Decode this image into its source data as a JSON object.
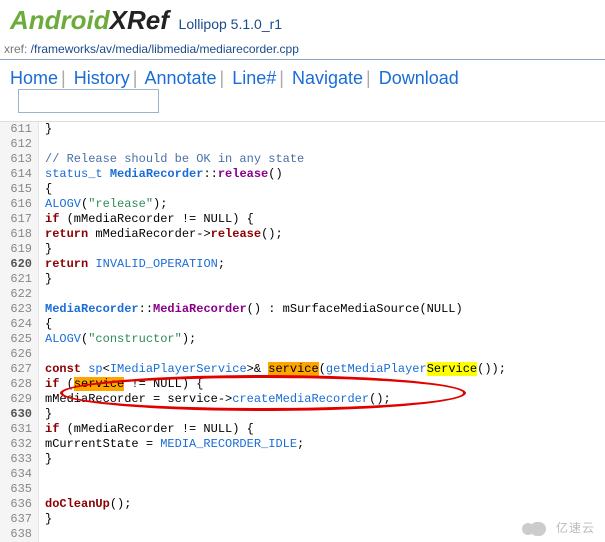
{
  "logo": {
    "part1": "Android",
    "part2": "XRef"
  },
  "version": "Lollipop 5.1.0_r1",
  "path": {
    "label": "xref: ",
    "segments": [
      "/",
      "frameworks",
      "/",
      "av",
      "/",
      "media",
      "/",
      "libmedia",
      "/",
      "mediarecorder.cpp"
    ]
  },
  "nav": {
    "items": [
      "Home",
      "History",
      "Annotate",
      "Line#",
      "Navigate",
      "Download"
    ]
  },
  "search_placeholder": "",
  "code": {
    "l611": "}",
    "l613_cmt": "// Release should be OK in any state",
    "l614": {
      "stat": "status_t",
      "cls": "MediaRecorder",
      "fn": "release",
      "rest": "()"
    },
    "l616": {
      "al": "ALOGV",
      "str": "\"release\""
    },
    "l617": {
      "if": "if",
      "cond": " (mMediaRecorder != NULL) {"
    },
    "l618": {
      "ret": "return",
      "mid": "mMediaRecorder->",
      "fn": "release",
      "end": "();"
    },
    "l619": "    }",
    "l620": {
      "ret": "return",
      "val": "INVALID_OPERATION"
    },
    "l621": "}",
    "l623": {
      "cls1": "MediaRecorder",
      "cls2": "MediaRecorder",
      "rest": "() : mSurfaceMediaSource(NULL)"
    },
    "l625": {
      "al": "ALOGV",
      "str": "\"constructor\""
    },
    "l627": {
      "cn": "const",
      "sp": "sp",
      "imps": "IMediaPlayerService",
      "amp": ">& ",
      "svc": "service",
      "par": "(",
      "get": "getMediaPlayer",
      "svc2": "Service",
      "end": "());"
    },
    "l628": {
      "if": "if",
      "pre": " (",
      "svc": "service",
      "post": " != NULL) {"
    },
    "l629": {
      "lhs": "mMediaRecorder = service->",
      "fn": "createMediaRecorder",
      "end": "();"
    },
    "l630": "    }",
    "l631": {
      "if": "if",
      "cond": " (mMediaRecorder != NULL) {"
    },
    "l632": {
      "lhs": "mCurrentState = ",
      "rhs": "MEDIA_RECORDER_IDLE",
      "end": ";"
    },
    "l633": "    }",
    "l636": {
      "fn": "doCleanUp",
      "end": "();"
    },
    "l637": "}"
  },
  "watermark": "亿速云"
}
